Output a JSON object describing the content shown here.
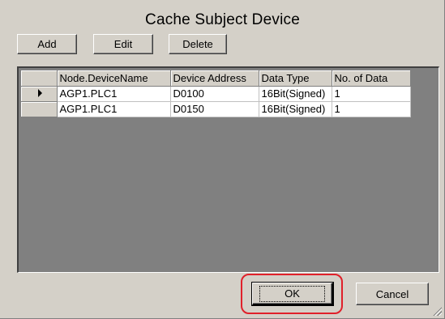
{
  "dialog": {
    "title": "Cache Subject Device"
  },
  "toolbar": {
    "add_label": "Add",
    "edit_label": "Edit",
    "delete_label": "Delete"
  },
  "grid": {
    "columns": [
      "Node.DeviceName",
      "Device Address",
      "Data Type",
      "No. of Data"
    ],
    "rows": [
      {
        "current": true,
        "cells": [
          "AGP1.PLC1",
          "D0100",
          "16Bit(Signed)",
          "1"
        ]
      },
      {
        "current": false,
        "cells": [
          "AGP1.PLC1",
          "D0150",
          "16Bit(Signed)",
          "1"
        ]
      }
    ],
    "current_row_icon": "current-row-arrow-icon"
  },
  "footer": {
    "ok_label": "OK",
    "cancel_label": "Cancel"
  },
  "colors": {
    "dialog_background": "#d4d0c8",
    "grid_background": "#808080",
    "highlight": "#e0202a"
  }
}
